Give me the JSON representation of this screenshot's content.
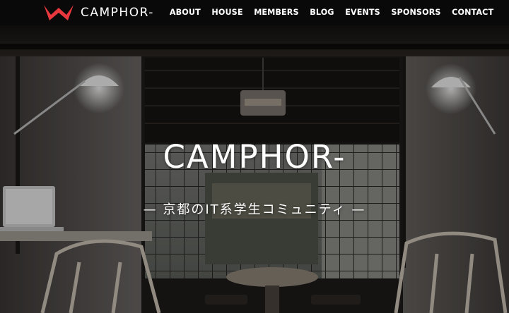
{
  "site": {
    "brand_name": "CAMPHOR-",
    "brand_color": "#e8383d"
  },
  "nav": {
    "items": [
      {
        "label": "ABOUT"
      },
      {
        "label": "HOUSE"
      },
      {
        "label": "MEMBERS"
      },
      {
        "label": "BLOG"
      },
      {
        "label": "EVENTS"
      },
      {
        "label": "SPONSORS"
      },
      {
        "label": "CONTACT"
      }
    ]
  },
  "hero": {
    "title": "CAMPHOR-",
    "tagline": "— 京都のIT系学生コミュニティ —"
  }
}
